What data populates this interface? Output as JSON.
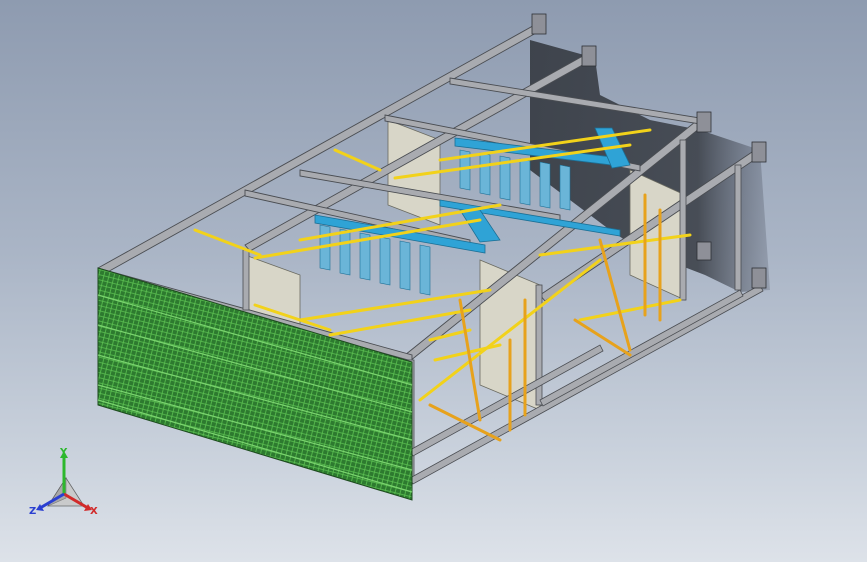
{
  "viewport": {
    "background_top": "#8e9bb0",
    "background_bottom": "#dde2e9"
  },
  "model": {
    "kind": "3D steel frame assembly with mesh screen and stairs",
    "colors": {
      "frame": "#a9abb0",
      "frame_edge": "#4a4d52",
      "yellow_members": "#f2d21a",
      "orange_members": "#e7a21c",
      "blue_stair_stringers": "#2fa3d6",
      "panel": "#d8d6c8",
      "mesh": "#2d7a2f",
      "mesh_line": "#56b84a",
      "shadow": "#3a3f47"
    }
  },
  "triad": {
    "icon": "coordinate-triad-icon",
    "axis_y": "Y",
    "axis_x": "X",
    "axis_z": "Z",
    "color_y": "#2db82d",
    "color_x": "#d12a2a",
    "color_z": "#2a3fd1"
  }
}
